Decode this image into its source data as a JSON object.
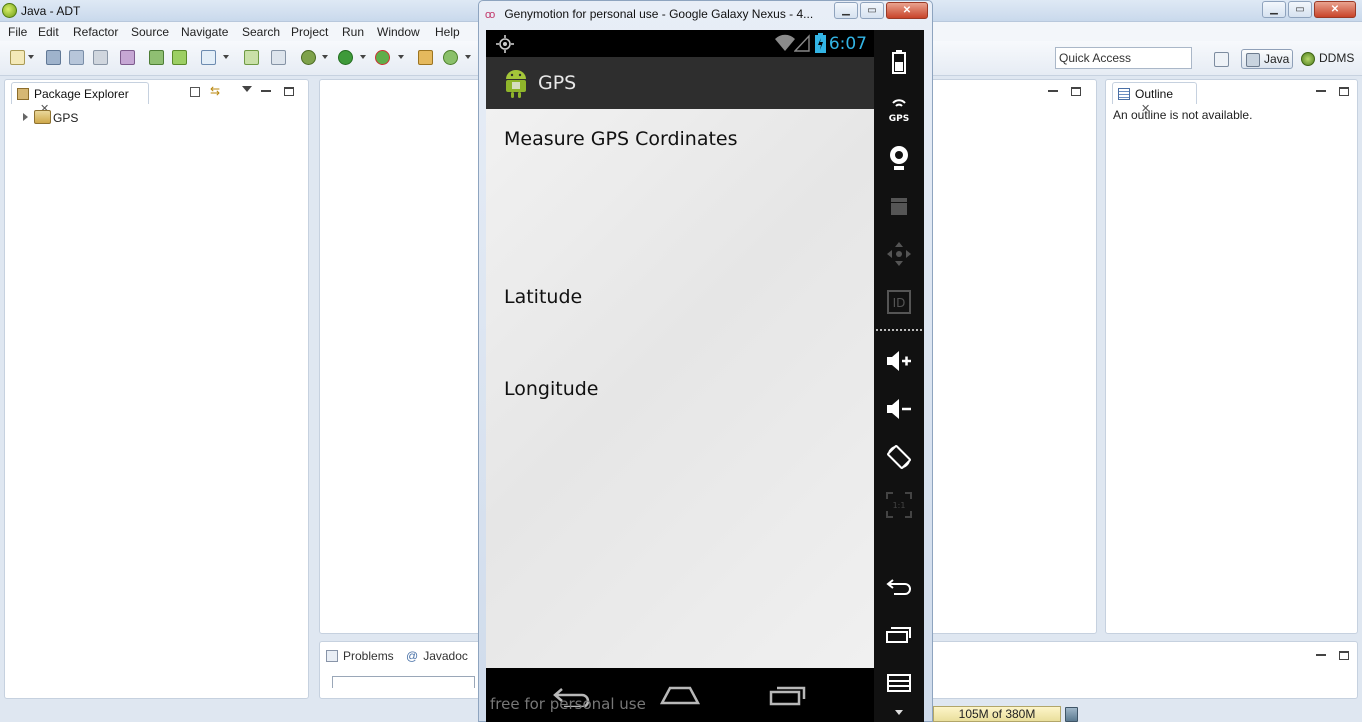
{
  "eclipse": {
    "title": "Java - ADT",
    "menu": [
      "File",
      "Edit",
      "Refactor",
      "Source",
      "Navigate",
      "Search",
      "Project",
      "Run",
      "Window",
      "Help"
    ],
    "quick_access": "Quick Access",
    "perspectives": {
      "java": "Java",
      "ddms": "DDMS"
    },
    "package_explorer": {
      "tab_label": "Package Explorer",
      "tree_items": [
        "GPS"
      ]
    },
    "outline": {
      "tab_label": "Outline",
      "message": "An outline is not available."
    },
    "bottom_tabs": {
      "problems": "Problems",
      "javadoc": "Javadoc"
    },
    "heap_status": "105M of 380M"
  },
  "genymotion": {
    "window_title": "Genymotion for personal use - Google Galaxy Nexus - 4...",
    "watermark": "free for personal use",
    "status_bar": {
      "time": "6:07"
    },
    "app": {
      "title": "GPS",
      "labels": {
        "heading": "Measure GPS Cordinates",
        "latitude": "Latitude",
        "longitude": "Longitude"
      }
    },
    "sidebar_icons": [
      "battery-icon",
      "gps-icon",
      "camera-icon",
      "video-capture-icon",
      "dpad-icon",
      "device-id-icon",
      "volume-up-icon",
      "volume-down-icon",
      "rotate-icon",
      "scale-icon",
      "back-icon",
      "recent-apps-icon",
      "menu-icon"
    ],
    "nav_icons": [
      "back-icon",
      "home-icon",
      "recent-apps-icon"
    ]
  },
  "colors": {
    "holo_blue": "#33b5e5",
    "action_bar": "#2e2e2e",
    "eclipse_bg": "#dfe7f1"
  }
}
